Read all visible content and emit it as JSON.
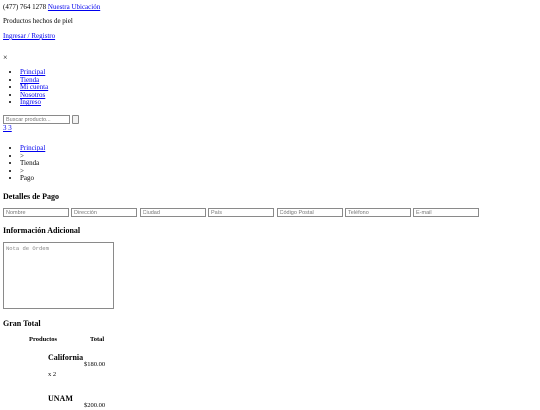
{
  "topbar": {
    "phone": "(477) 764 1278",
    "location_link": "Nuestra Ubicación"
  },
  "tagline": "Productos hechos de piel",
  "auth_link": "Ingresar / Registro",
  "close_symbol": "×",
  "nav": {
    "items": [
      "Principal",
      "Tienda",
      "Mi cuenta",
      "Nosotros",
      "Ingreso"
    ]
  },
  "search": {
    "placeholder": "Buscar producto..."
  },
  "cart_link": " 3 3",
  "breadcrumb": {
    "home": "Principal",
    "sep1": ">",
    "shop": "Tienda",
    "sep2": ">",
    "current": "Pago"
  },
  "billing": {
    "heading": "Detalles de Pago",
    "fields": {
      "name": "Nombre",
      "address": "Dirección",
      "city": "Ciudad",
      "country": "País",
      "zip": "Código Postal",
      "phone": "Teléfono",
      "email": "E-mail"
    }
  },
  "additional": {
    "heading": "Información Adicional",
    "notes_placeholder": "Nota de Ordem"
  },
  "total": {
    "heading": "Gran Total",
    "col_products": "Productos",
    "col_total": "Total",
    "items": [
      {
        "name": "California",
        "qty": "x 2",
        "price": "$180.00"
      },
      {
        "name": "UNAM",
        "qty": "",
        "price": "$200.00"
      }
    ]
  }
}
